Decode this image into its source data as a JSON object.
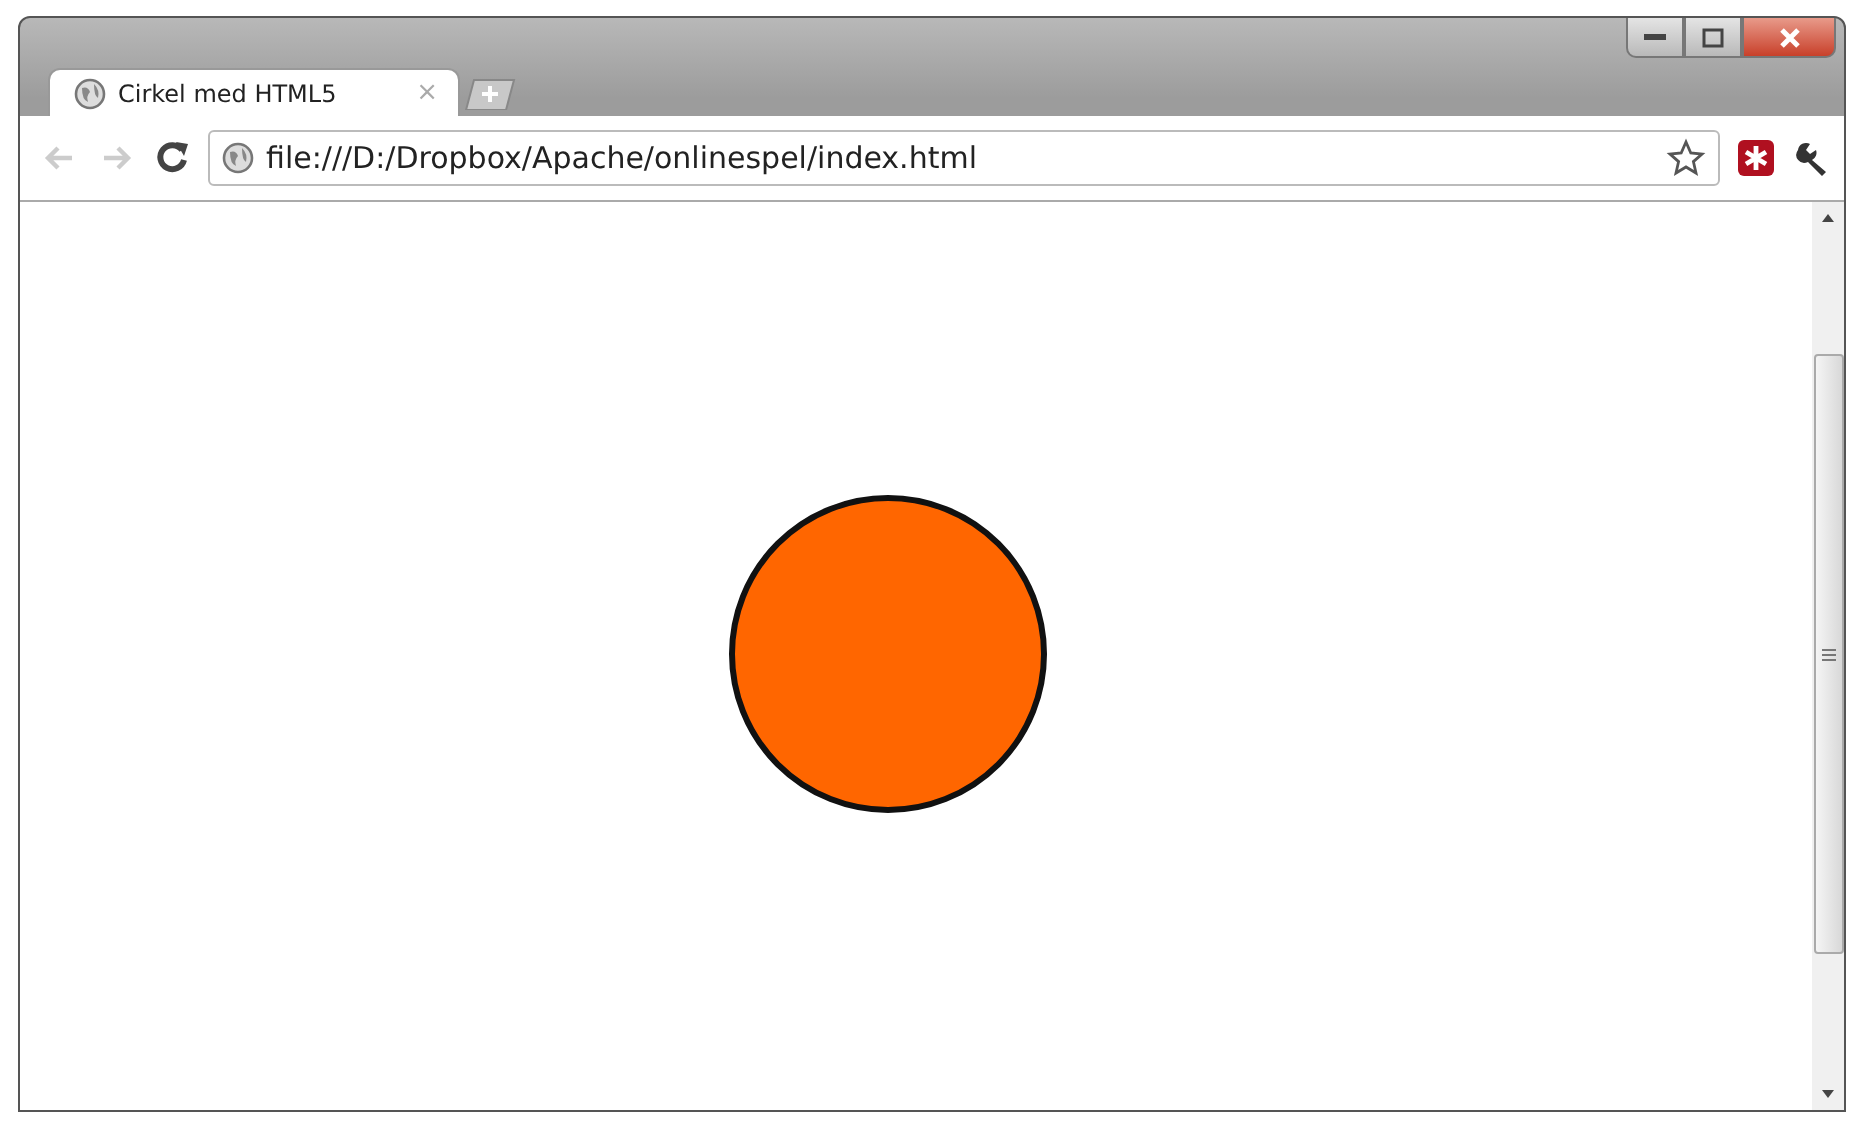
{
  "tabs": [
    {
      "title": "Cirkel med HTML5",
      "close": "×",
      "selected": true
    }
  ],
  "address_bar": {
    "value": "file:///D:/Dropbox/Apache/onlinespel/index.html"
  }
}
